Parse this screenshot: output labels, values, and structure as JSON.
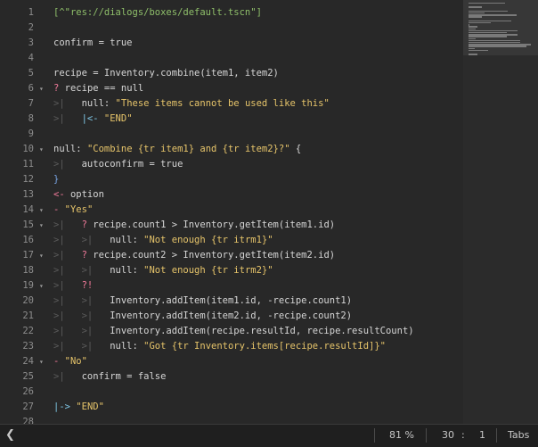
{
  "editor": {
    "lines": [
      {
        "n": "1",
        "fold": "",
        "tokens": [
          [
            "t-path",
            "[^\"res://dialogs/boxes/default.tscn\"]"
          ]
        ]
      },
      {
        "n": "2",
        "fold": "",
        "tokens": []
      },
      {
        "n": "3",
        "fold": "",
        "tokens": [
          [
            "t-plain",
            "confirm = true"
          ]
        ]
      },
      {
        "n": "4",
        "fold": "",
        "tokens": []
      },
      {
        "n": "5",
        "fold": "",
        "tokens": [
          [
            "t-plain",
            "recipe = Inventory.combine(item1, item2)"
          ]
        ]
      },
      {
        "n": "6",
        "fold": "v",
        "tokens": [
          [
            "t-kw",
            "? "
          ],
          [
            "t-plain",
            "recipe == null"
          ]
        ]
      },
      {
        "n": "7",
        "fold": "",
        "tokens": [
          [
            "t-guide",
            ">|   "
          ],
          [
            "t-plain",
            "null: "
          ],
          [
            "t-str",
            "\"These items cannot be used like this\""
          ]
        ]
      },
      {
        "n": "8",
        "fold": "",
        "tokens": [
          [
            "t-guide",
            ">|   "
          ],
          [
            "t-cyan",
            "|<- "
          ],
          [
            "t-str",
            "\"END\""
          ]
        ]
      },
      {
        "n": "9",
        "fold": "",
        "tokens": []
      },
      {
        "n": "10",
        "fold": "v",
        "tokens": [
          [
            "t-plain",
            "null: "
          ],
          [
            "t-str",
            "\"Combine {tr item1} and {tr item2}?\""
          ],
          [
            "t-plain",
            " {"
          ]
        ]
      },
      {
        "n": "11",
        "fold": "",
        "tokens": [
          [
            "t-guide",
            ">|   "
          ],
          [
            "t-plain",
            "autoconfirm = true"
          ]
        ]
      },
      {
        "n": "12",
        "fold": "",
        "tokens": [
          [
            "t-br",
            "}"
          ]
        ]
      },
      {
        "n": "13",
        "fold": "",
        "tokens": [
          [
            "t-arrow",
            "<- "
          ],
          [
            "t-plain",
            "option"
          ]
        ]
      },
      {
        "n": "14",
        "fold": "v",
        "tokens": [
          [
            "t-kw",
            "- "
          ],
          [
            "t-str",
            "\"Yes\""
          ]
        ]
      },
      {
        "n": "15",
        "fold": "v",
        "tokens": [
          [
            "t-guide",
            ">|   "
          ],
          [
            "t-kw",
            "? "
          ],
          [
            "t-plain",
            "recipe.count1 > Inventory.getItem(item1.id)"
          ]
        ]
      },
      {
        "n": "16",
        "fold": "",
        "tokens": [
          [
            "t-guide",
            ">|   >|   "
          ],
          [
            "t-plain",
            "null: "
          ],
          [
            "t-str",
            "\"Not enough {tr itrm1}\""
          ]
        ]
      },
      {
        "n": "17",
        "fold": "v",
        "tokens": [
          [
            "t-guide",
            ">|   "
          ],
          [
            "t-kw",
            "? "
          ],
          [
            "t-plain",
            "recipe.count2 > Inventory.getItem(item2.id)"
          ]
        ]
      },
      {
        "n": "18",
        "fold": "",
        "tokens": [
          [
            "t-guide",
            ">|   >|   "
          ],
          [
            "t-plain",
            "null: "
          ],
          [
            "t-str",
            "\"Not enough {tr itrm2}\""
          ]
        ]
      },
      {
        "n": "19",
        "fold": "v",
        "tokens": [
          [
            "t-guide",
            ">|   "
          ],
          [
            "t-kw",
            "?!"
          ]
        ]
      },
      {
        "n": "20",
        "fold": "",
        "tokens": [
          [
            "t-guide",
            ">|   >|   "
          ],
          [
            "t-plain",
            "Inventory.addItem(item1.id, -recipe.count1)"
          ]
        ]
      },
      {
        "n": "21",
        "fold": "",
        "tokens": [
          [
            "t-guide",
            ">|   >|   "
          ],
          [
            "t-plain",
            "Inventory.addItem(item2.id, -recipe.count2)"
          ]
        ]
      },
      {
        "n": "22",
        "fold": "",
        "tokens": [
          [
            "t-guide",
            ">|   >|   "
          ],
          [
            "t-plain",
            "Inventory.addItem(recipe.resultId, recipe.resultCount)"
          ]
        ]
      },
      {
        "n": "23",
        "fold": "",
        "tokens": [
          [
            "t-guide",
            ">|   >|   "
          ],
          [
            "t-plain",
            "null: "
          ],
          [
            "t-str",
            "\"Got {tr Inventory.items[recipe.resultId]}\""
          ]
        ]
      },
      {
        "n": "24",
        "fold": "v",
        "tokens": [
          [
            "t-kw",
            "- "
          ],
          [
            "t-str",
            "\"No\""
          ]
        ]
      },
      {
        "n": "25",
        "fold": "",
        "tokens": [
          [
            "t-guide",
            ">|   "
          ],
          [
            "t-plain",
            "confirm = false"
          ]
        ]
      },
      {
        "n": "26",
        "fold": "",
        "tokens": []
      },
      {
        "n": "27",
        "fold": "",
        "tokens": [
          [
            "t-cyan",
            "|-> "
          ],
          [
            "t-str",
            "\"END\""
          ]
        ]
      },
      {
        "n": "28",
        "fold": "",
        "tokens": []
      }
    ]
  },
  "statusbar": {
    "back_glyph": "❮",
    "zoom": "81 %",
    "line": "30",
    "sep": ":",
    "col": "1",
    "indent": "Tabs"
  },
  "colors": {
    "background": "#282828",
    "string": "#e6c46a",
    "keyword": "#f07a9a",
    "path": "#8fbf6a"
  },
  "icons": {
    "fold": "chevron-down-icon",
    "back": "chevron-left-icon"
  }
}
